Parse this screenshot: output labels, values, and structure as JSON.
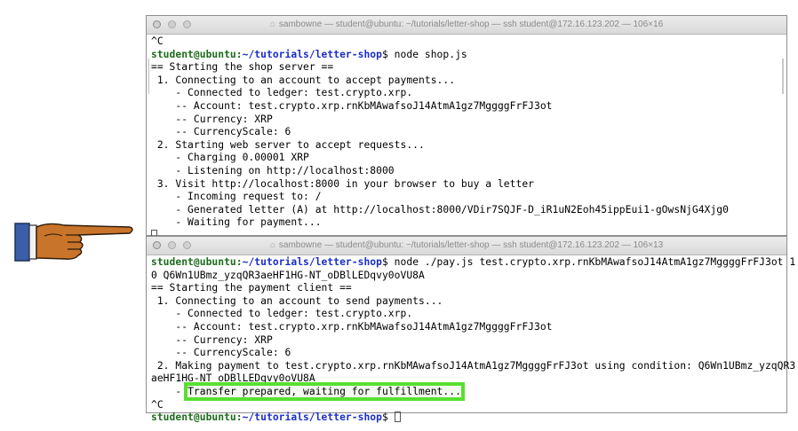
{
  "terminal_top": {
    "title": "sambowne — student@ubuntu: ~/tutorials/letter-shop — ssh student@172.16.123.202 — 106×16",
    "lines": [
      {
        "type": "plain",
        "text": "^C"
      },
      {
        "type": "prompt",
        "user": "student@ubuntu",
        "path": "~/tutorials/letter-shop",
        "cmd": " node shop.js"
      },
      {
        "type": "plain",
        "text": "== Starting the shop server =="
      },
      {
        "type": "plain",
        "text": " 1. Connecting to an account to accept payments..."
      },
      {
        "type": "plain",
        "text": "    - Connected to ledger: test.crypto.xrp."
      },
      {
        "type": "plain",
        "text": "    -- Account: test.crypto.xrp.rnKbMAwafsoJ14AtmA1gz7MggggFrFJ3ot"
      },
      {
        "type": "plain",
        "text": "    -- Currency: XRP"
      },
      {
        "type": "plain",
        "text": "    -- CurrencyScale: 6"
      },
      {
        "type": "plain",
        "text": " 2. Starting web server to accept requests..."
      },
      {
        "type": "plain",
        "text": "    - Charging 0.00001 XRP"
      },
      {
        "type": "plain",
        "text": "    - Listening on http://localhost:8000"
      },
      {
        "type": "plain",
        "text": " 3. Visit http://localhost:8000 in your browser to buy a letter"
      },
      {
        "type": "plain",
        "text": "    - Incoming request to: /"
      },
      {
        "type": "plain",
        "text": "    - Generated letter (A) at http://localhost:8000/VDir7SQJF-D_iR1uN2Eoh45ippEui1-gOwsNjG4Xjg0"
      },
      {
        "type": "plain",
        "text": "    - Waiting for payment..."
      },
      {
        "type": "cursor"
      }
    ]
  },
  "terminal_bottom": {
    "title": "sambowne — student@ubuntu: ~/tutorials/letter-shop — ssh student@172.16.123.202 — 106×13",
    "lines": [
      {
        "type": "prompt",
        "user": "student@ubuntu",
        "path": "~/tutorials/letter-shop",
        "cmd": " node ./pay.js test.crypto.xrp.rnKbMAwafsoJ14AtmA1gz7MggggFrFJ3ot 1"
      },
      {
        "type": "plain",
        "text": "0 Q6Wn1UBmz_yzqQR3aeHF1HG-NT_oDBlLEDqvy0oVU8A"
      },
      {
        "type": "plain",
        "text": "== Starting the payment client =="
      },
      {
        "type": "plain",
        "text": " 1. Connecting to an account to send payments..."
      },
      {
        "type": "plain",
        "text": "    - Connected to ledger: test.crypto.xrp."
      },
      {
        "type": "plain",
        "text": "    -- Account: test.crypto.xrp.rnKbMAwafsoJ14AtmA1gz7MggggFrFJ3ot"
      },
      {
        "type": "plain",
        "text": "    -- Currency: XRP"
      },
      {
        "type": "plain",
        "text": "    -- CurrencyScale: 6"
      },
      {
        "type": "plain",
        "text": " 2. Making payment to test.crypto.xrp.rnKbMAwafsoJ14AtmA1gz7MggggFrFJ3ot using condition: Q6Wn1UBmz_yzqQR3"
      },
      {
        "type": "plain",
        "text": "aeHF1HG-NT_oDBlLEDqvy0oVU8A"
      },
      {
        "type": "highlight",
        "prefix": "    - ",
        "text": "Transfer prepared, waiting for fulfillment..."
      },
      {
        "type": "plain",
        "text": "^C"
      },
      {
        "type": "prompt_cursor",
        "user": "student@ubuntu",
        "path": "~/tutorials/letter-shop",
        "cmd": " "
      }
    ]
  },
  "colors": {
    "user": "#1c6b1c",
    "path": "#1b2ec9",
    "highlight": "#57e030",
    "hand": "#b5651d"
  },
  "icons": {
    "pointer": "pointing-hand-icon",
    "home": "home-folder-icon"
  }
}
